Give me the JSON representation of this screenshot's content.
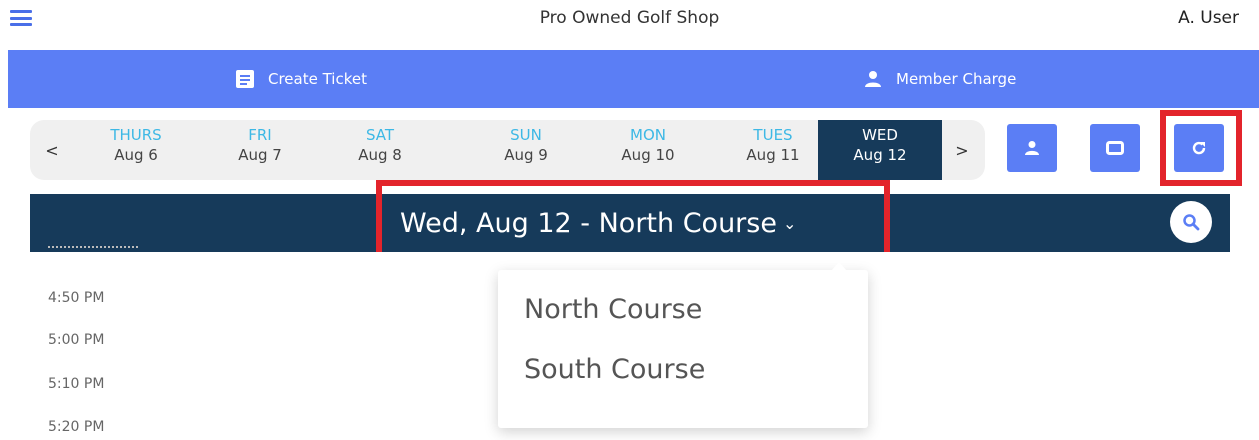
{
  "header": {
    "menu_icon": "hamburger-menu-icon",
    "title": "Pro Owned Golf Shop",
    "user": "A. User"
  },
  "actions": {
    "create_ticket": {
      "label": "Create Ticket",
      "icon": "ticket-icon"
    },
    "member_charge": {
      "label": "Member Charge",
      "icon": "person-icon"
    }
  },
  "date_nav": {
    "prev": "<",
    "next": ">",
    "days": [
      {
        "name": "THURS",
        "date": "Aug 6"
      },
      {
        "name": "FRI",
        "date": "Aug 7"
      },
      {
        "name": "SAT",
        "date": "Aug 8"
      },
      {
        "name": "SUN",
        "date": "Aug 9"
      },
      {
        "name": "MON",
        "date": "Aug 10"
      },
      {
        "name": "TUES",
        "date": "Aug 11"
      },
      {
        "name": "WED",
        "date": "Aug 12",
        "selected": true
      }
    ]
  },
  "tools": {
    "person": "person-icon",
    "window": "window-icon",
    "refresh": "refresh-icon"
  },
  "course_bar": {
    "selected": "Wed, Aug 12 - North Course",
    "search_icon": "search-icon"
  },
  "course_dropdown": {
    "options": [
      "North Course",
      "South Course"
    ]
  },
  "times": [
    "4:50 PM",
    "5:00 PM",
    "5:10 PM",
    "5:20 PM"
  ],
  "colors": {
    "primary": "#5b7ef5",
    "navy": "#163a5a",
    "day_label": "#3db8e5",
    "highlight": "#e3242b"
  }
}
